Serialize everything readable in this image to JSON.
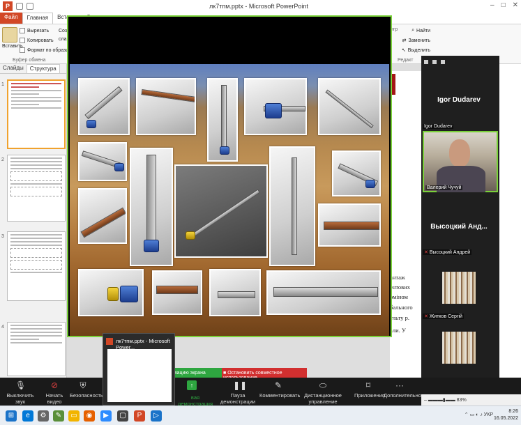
{
  "window": {
    "title": "лк7тпм.pptx - Microsoft PowerPoint",
    "app_badge": "P"
  },
  "ribbon": {
    "tabs": [
      "Файл",
      "Главная",
      "Вставка",
      "Д"
    ],
    "clipboard": {
      "paste": "Вставить",
      "cut": "Вырезать",
      "copy": "Копировать",
      "format_painter": "Формат по образцу",
      "group_label": "Буфер обмена"
    },
    "cut_left_labels": [
      "Созд",
      "слай"
    ],
    "right_groups": {
      "find": "Найти",
      "replace": "Заменить",
      "select": "Выделить",
      "group_label": "Редакт",
      "cut_label": "нгр"
    }
  },
  "panel": {
    "tabs": [
      "Слайды",
      "Структура"
    ],
    "slide_numbers": [
      "1",
      "2",
      "3",
      "4"
    ]
  },
  "slide_text_right": [
    "антаж",
    "ентових",
    "оміном",
    "бального",
    "ульту р.",
    "али. У"
  ],
  "meeting": {
    "participants": [
      {
        "big_name": "Igor Dudarev",
        "label": "Igor Dudarev"
      },
      {
        "label": "Валерий Чучуй"
      },
      {
        "big_name": "Высоцкий Анд...",
        "label": "Высоцкий Андрей"
      },
      {
        "label": "Житков Сергій"
      }
    ],
    "share_bar": {
      "demo_label": "вацию экрана",
      "stop_label": "Остановить совместное использование"
    },
    "controls": [
      {
        "label": "Выключить звук",
        "icon": "microphone-icon"
      },
      {
        "label": "Начать видео",
        "icon": "video-off-icon"
      },
      {
        "label": "Безопасность",
        "icon": "shield-icon"
      },
      {
        "label": "вая демонстрация",
        "icon": "share-screen-icon"
      },
      {
        "label": "Пауза демонстрации",
        "icon": "pause-icon"
      },
      {
        "label": "Комментировать",
        "icon": "pencil-icon"
      },
      {
        "label": "Дистанционное управление",
        "icon": "mouse-icon"
      },
      {
        "label": "Приложения",
        "icon": "apps-icon"
      },
      {
        "label": "Дополнительно",
        "icon": "more-icon"
      }
    ]
  },
  "preview": {
    "title": "лк7тпм.pptx - Microsoft Power..."
  },
  "status": {
    "zoom": "83%"
  },
  "taskbar": {
    "lang": "УКР",
    "time": "8:26",
    "date": "16.05.2022"
  }
}
